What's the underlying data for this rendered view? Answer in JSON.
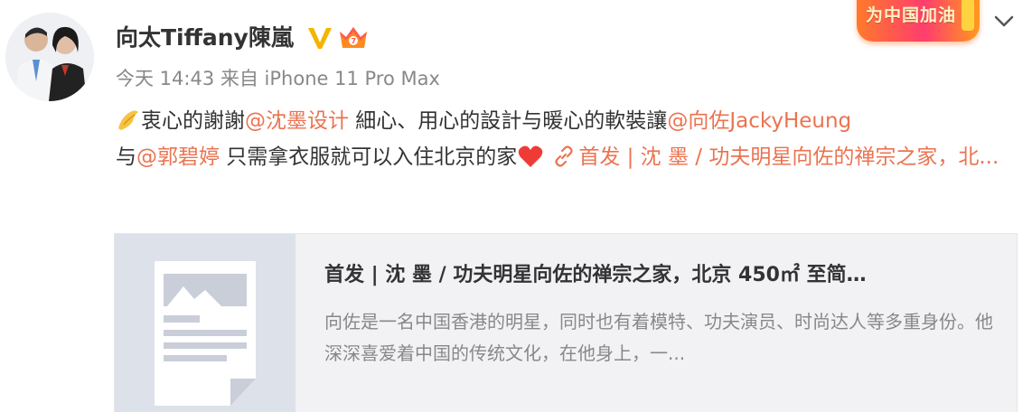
{
  "user": {
    "name": "向太Tiffany陳嵐"
  },
  "meta": {
    "text": "今天 14:43 来自 iPhone 11 Pro Max"
  },
  "banner": {
    "text": "为中国加油"
  },
  "post": {
    "part1": "衷心的謝謝",
    "mention1": "@沈墨设计",
    "part2": " 細心、用心的設計与暖心的軟裝讓",
    "mention2": "@向佐JackyHeung",
    "part3": "与",
    "mention3": "@郭碧婷",
    "part4": " 只需拿衣服就可以入住北京的家",
    "link_text": "首发 | 沈 墨 / 功夫明星向佐的禅宗之家，北..."
  },
  "card": {
    "title": "首发 | 沈 墨 / 功夫明星向佐的禅宗之家，北京 450㎡ 至简…",
    "description": "向佐是一名中国香港的明星，同时也有着模特、功夫演员、时尚达人等多重身份。他深深喜爱着中国的传统文化，在他身上，一..."
  },
  "colors": {
    "accent": "#eb7350",
    "meta_text": "#888888",
    "card_bg": "#f2f2f5",
    "verified": "#f5b400"
  },
  "icons": [
    "avatar",
    "verified-v-icon",
    "crown-badge-icon",
    "chevron-down-icon",
    "bow-emoji-icon",
    "heart-emoji-icon",
    "link-icon",
    "article-placeholder-icon"
  ]
}
